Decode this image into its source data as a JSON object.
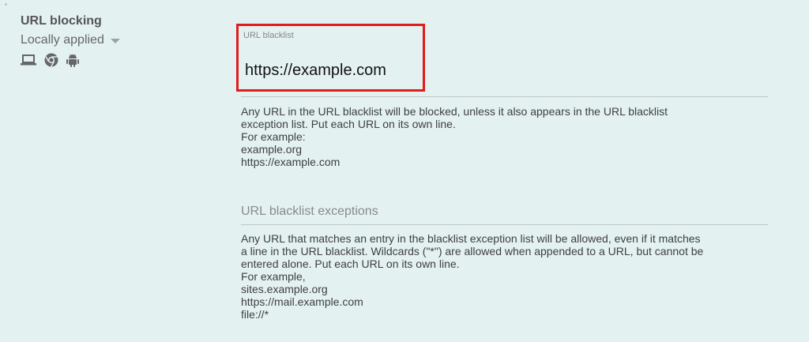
{
  "setting": {
    "title": "URL blocking",
    "scope": "Locally applied",
    "platform_icons": [
      "laptop-icon",
      "chrome-icon",
      "android-icon"
    ]
  },
  "blacklist": {
    "label": "URL blacklist",
    "value": "https://example.com",
    "highlight_color": "#e21b1b",
    "help_lines": [
      "Any URL in the URL blacklist will be blocked, unless it also appears in the URL blacklist",
      "exception list. Put each URL on its own line.",
      "For example:",
      "example.org",
      "https://example.com"
    ]
  },
  "exceptions": {
    "label": "URL blacklist exceptions",
    "help_lines": [
      "Any URL that matches an entry in the blacklist exception list will be allowed, even if it matches",
      "a line in the URL blacklist. Wildcards (\"*\") are allowed when appended to a URL, but cannot be",
      "entered alone. Put each URL on its own line.",
      "For example,",
      "sites.example.org",
      "https://mail.example.com",
      "file://*"
    ]
  }
}
